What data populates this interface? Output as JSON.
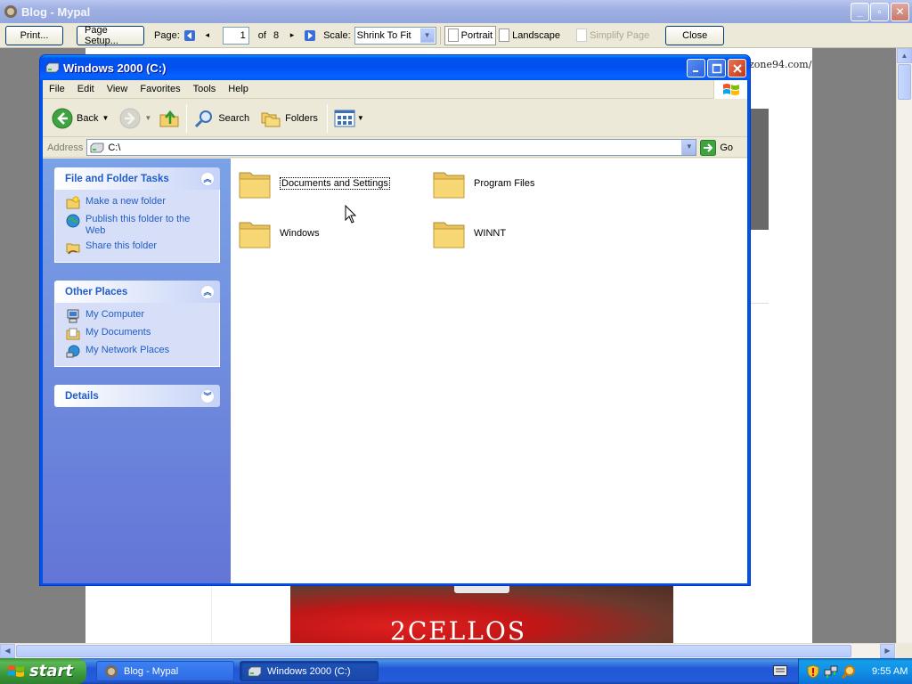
{
  "browser": {
    "title": "Blog - Mypal",
    "print_preview": {
      "print_label": "Print...",
      "page_setup_label": "Page Setup...",
      "page_label": "Page:",
      "page_value": "1",
      "of_label": "of",
      "total_pages": "8",
      "scale_label": "Scale:",
      "scale_value": "Shrink To Fit",
      "portrait_label": "Portrait",
      "landscape_label": "Landscape",
      "simplify_label": "Simplify Page",
      "close_label": "Close"
    },
    "page_content": {
      "url_fragment": "zone94.com/",
      "image_text": "2CELLOS"
    }
  },
  "explorer": {
    "title": "Windows 2000 (C:)",
    "menu": [
      "File",
      "Edit",
      "View",
      "Favorites",
      "Tools",
      "Help"
    ],
    "toolbar": {
      "back_label": "Back",
      "search_label": "Search",
      "folders_label": "Folders"
    },
    "address": {
      "label": "Address",
      "value": "C:\\",
      "go_label": "Go"
    },
    "tasks": {
      "title": "File and Folder Tasks",
      "items": [
        "Make a new folder",
        "Publish this folder to the Web",
        "Share this folder"
      ]
    },
    "other_places": {
      "title": "Other Places",
      "items": [
        "My Computer",
        "My Documents",
        "My Network Places"
      ]
    },
    "details": {
      "title": "Details"
    },
    "folders": [
      "Documents and Settings",
      "Program Files",
      "Windows",
      "WINNT"
    ],
    "colors": {
      "title_blue": "#0054e3",
      "task_link": "#215dc6",
      "folder_yellow": "#f7d774"
    }
  },
  "taskbar": {
    "start_label": "start",
    "tasks": [
      "Blog - Mypal",
      "Windows 2000 (C:)"
    ],
    "clock": "9:55 AM"
  }
}
